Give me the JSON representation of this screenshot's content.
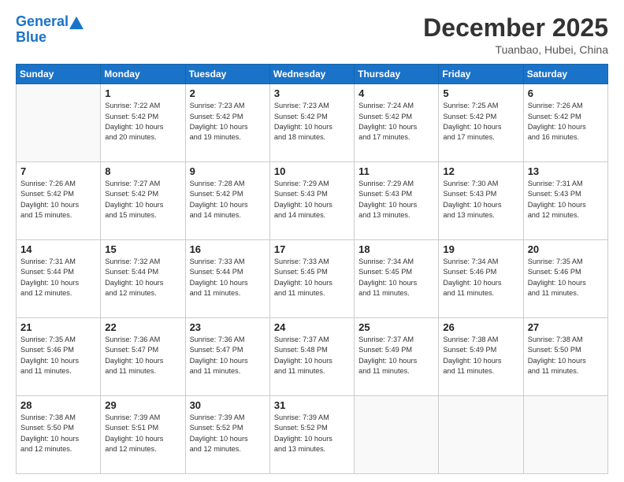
{
  "header": {
    "logo_line1": "General",
    "logo_line2": "Blue",
    "month": "December 2025",
    "location": "Tuanbao, Hubei, China"
  },
  "days_of_week": [
    "Sunday",
    "Monday",
    "Tuesday",
    "Wednesday",
    "Thursday",
    "Friday",
    "Saturday"
  ],
  "weeks": [
    [
      {
        "day": "",
        "info": ""
      },
      {
        "day": "1",
        "info": "Sunrise: 7:22 AM\nSunset: 5:42 PM\nDaylight: 10 hours\nand 20 minutes."
      },
      {
        "day": "2",
        "info": "Sunrise: 7:23 AM\nSunset: 5:42 PM\nDaylight: 10 hours\nand 19 minutes."
      },
      {
        "day": "3",
        "info": "Sunrise: 7:23 AM\nSunset: 5:42 PM\nDaylight: 10 hours\nand 18 minutes."
      },
      {
        "day": "4",
        "info": "Sunrise: 7:24 AM\nSunset: 5:42 PM\nDaylight: 10 hours\nand 17 minutes."
      },
      {
        "day": "5",
        "info": "Sunrise: 7:25 AM\nSunset: 5:42 PM\nDaylight: 10 hours\nand 17 minutes."
      },
      {
        "day": "6",
        "info": "Sunrise: 7:26 AM\nSunset: 5:42 PM\nDaylight: 10 hours\nand 16 minutes."
      }
    ],
    [
      {
        "day": "7",
        "info": "Sunrise: 7:26 AM\nSunset: 5:42 PM\nDaylight: 10 hours\nand 15 minutes."
      },
      {
        "day": "8",
        "info": "Sunrise: 7:27 AM\nSunset: 5:42 PM\nDaylight: 10 hours\nand 15 minutes."
      },
      {
        "day": "9",
        "info": "Sunrise: 7:28 AM\nSunset: 5:42 PM\nDaylight: 10 hours\nand 14 minutes."
      },
      {
        "day": "10",
        "info": "Sunrise: 7:29 AM\nSunset: 5:43 PM\nDaylight: 10 hours\nand 14 minutes."
      },
      {
        "day": "11",
        "info": "Sunrise: 7:29 AM\nSunset: 5:43 PM\nDaylight: 10 hours\nand 13 minutes."
      },
      {
        "day": "12",
        "info": "Sunrise: 7:30 AM\nSunset: 5:43 PM\nDaylight: 10 hours\nand 13 minutes."
      },
      {
        "day": "13",
        "info": "Sunrise: 7:31 AM\nSunset: 5:43 PM\nDaylight: 10 hours\nand 12 minutes."
      }
    ],
    [
      {
        "day": "14",
        "info": "Sunrise: 7:31 AM\nSunset: 5:44 PM\nDaylight: 10 hours\nand 12 minutes."
      },
      {
        "day": "15",
        "info": "Sunrise: 7:32 AM\nSunset: 5:44 PM\nDaylight: 10 hours\nand 12 minutes."
      },
      {
        "day": "16",
        "info": "Sunrise: 7:33 AM\nSunset: 5:44 PM\nDaylight: 10 hours\nand 11 minutes."
      },
      {
        "day": "17",
        "info": "Sunrise: 7:33 AM\nSunset: 5:45 PM\nDaylight: 10 hours\nand 11 minutes."
      },
      {
        "day": "18",
        "info": "Sunrise: 7:34 AM\nSunset: 5:45 PM\nDaylight: 10 hours\nand 11 minutes."
      },
      {
        "day": "19",
        "info": "Sunrise: 7:34 AM\nSunset: 5:46 PM\nDaylight: 10 hours\nand 11 minutes."
      },
      {
        "day": "20",
        "info": "Sunrise: 7:35 AM\nSunset: 5:46 PM\nDaylight: 10 hours\nand 11 minutes."
      }
    ],
    [
      {
        "day": "21",
        "info": "Sunrise: 7:35 AM\nSunset: 5:46 PM\nDaylight: 10 hours\nand 11 minutes."
      },
      {
        "day": "22",
        "info": "Sunrise: 7:36 AM\nSunset: 5:47 PM\nDaylight: 10 hours\nand 11 minutes."
      },
      {
        "day": "23",
        "info": "Sunrise: 7:36 AM\nSunset: 5:47 PM\nDaylight: 10 hours\nand 11 minutes."
      },
      {
        "day": "24",
        "info": "Sunrise: 7:37 AM\nSunset: 5:48 PM\nDaylight: 10 hours\nand 11 minutes."
      },
      {
        "day": "25",
        "info": "Sunrise: 7:37 AM\nSunset: 5:49 PM\nDaylight: 10 hours\nand 11 minutes."
      },
      {
        "day": "26",
        "info": "Sunrise: 7:38 AM\nSunset: 5:49 PM\nDaylight: 10 hours\nand 11 minutes."
      },
      {
        "day": "27",
        "info": "Sunrise: 7:38 AM\nSunset: 5:50 PM\nDaylight: 10 hours\nand 11 minutes."
      }
    ],
    [
      {
        "day": "28",
        "info": "Sunrise: 7:38 AM\nSunset: 5:50 PM\nDaylight: 10 hours\nand 12 minutes."
      },
      {
        "day": "29",
        "info": "Sunrise: 7:39 AM\nSunset: 5:51 PM\nDaylight: 10 hours\nand 12 minutes."
      },
      {
        "day": "30",
        "info": "Sunrise: 7:39 AM\nSunset: 5:52 PM\nDaylight: 10 hours\nand 12 minutes."
      },
      {
        "day": "31",
        "info": "Sunrise: 7:39 AM\nSunset: 5:52 PM\nDaylight: 10 hours\nand 13 minutes."
      },
      {
        "day": "",
        "info": ""
      },
      {
        "day": "",
        "info": ""
      },
      {
        "day": "",
        "info": ""
      }
    ]
  ]
}
